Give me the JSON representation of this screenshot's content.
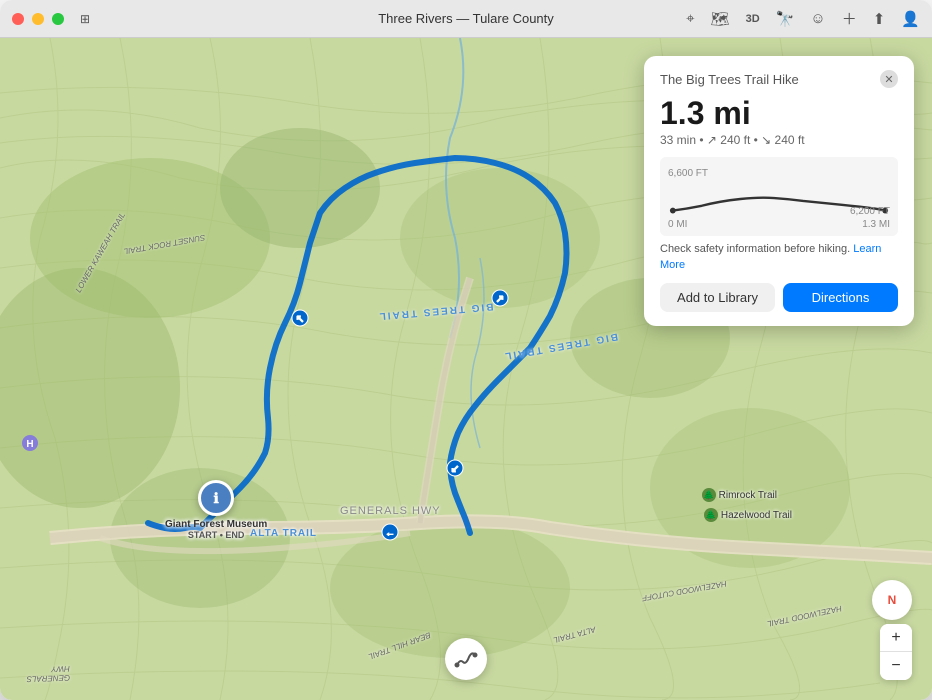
{
  "window": {
    "title": "Three Rivers — Tulare County",
    "traffic_lights": [
      "close",
      "minimize",
      "maximize"
    ]
  },
  "toolbar": {
    "icons": [
      "navigation",
      "map",
      "3d",
      "binoculars",
      "face",
      "plus",
      "share",
      "account"
    ]
  },
  "card": {
    "title": "The Big Trees Trail Hike",
    "distance": "1.3 mi",
    "time": "33 min",
    "elev_up": "↗ 240 ft",
    "elev_down": "↘ 240 ft",
    "meta": "33 min • ↗ 240 ft • ↘ 240 ft",
    "elev_high_label": "6,600 FT",
    "elev_low_label": "6,200 FT",
    "dist_start": "0 MI",
    "dist_end": "1.3 MI",
    "safety_text": "Check safety information before hiking.",
    "learn_more": "Learn More",
    "btn_library": "Add to Library",
    "btn_directions": "Directions"
  },
  "map": {
    "trail_label_1": "BIG TREES TRAIL",
    "trail_label_2": "BIG TREES TRAIL",
    "alta_trail": "ALTA TRAIL",
    "generals_hwy": "GENERALS HWY",
    "marker_title": "Giant Forest\nMuseum",
    "marker_sub": "START • END",
    "poi_rimrock": "Rimrock Trail",
    "poi_hazelwood": "Hazelwood Trail"
  },
  "controls": {
    "compass": "N",
    "zoom_in": "+",
    "zoom_out": "−"
  }
}
